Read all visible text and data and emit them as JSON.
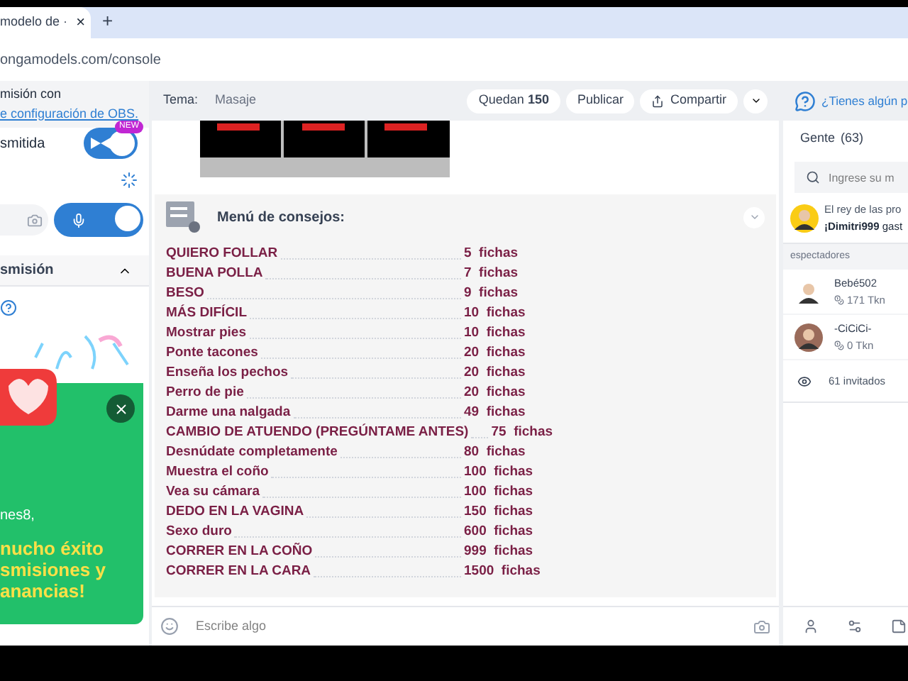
{
  "browser": {
    "tab_title": "modelo de ·",
    "close": "×",
    "new_tab": "+",
    "url": "ongamodels.com/console"
  },
  "left_panel": {
    "obs_line": "misión con",
    "obs_link": "e configuración de OBS.",
    "broadcast_label": "smitida",
    "broadcast_toggle": {
      "on": true,
      "badge": "NEW"
    },
    "mic_toggle": {
      "on": true
    },
    "section_title": "smisión",
    "section_expanded": true,
    "promo": {
      "greeting": "nes8,",
      "message": "nucho éxito smisiones y anancias!"
    }
  },
  "topic_bar": {
    "label": "Tema:",
    "value": "Masaje",
    "remaining_prefix": "Quedan",
    "remaining": "150",
    "publish": "Publicar",
    "share": "Compartir"
  },
  "tip_menu": {
    "title": "Menú de consejos:",
    "items": [
      {
        "name": "QUIERO FOLLAR",
        "price": "5  fichas"
      },
      {
        "name": "BUENA POLLA",
        "price": "7  fichas"
      },
      {
        "name": "BESO",
        "price": "9  fichas"
      },
      {
        "name": "MÁS DIFÍCIL",
        "price": "10  fichas"
      },
      {
        "name": "Mostrar pies",
        "price": "10  fichas"
      },
      {
        "name": "Ponte tacones",
        "price": "20  fichas"
      },
      {
        "name": "Enseña los pechos",
        "price": "20  fichas"
      },
      {
        "name": "Perro de pie",
        "price": "20  fichas"
      },
      {
        "name": "Darme una nalgada",
        "price": "49  fichas"
      },
      {
        "name": "CAMBIO DE ATUENDO (PREGÚNTAME ANTES)",
        "price": "75  fichas"
      },
      {
        "name": "Desnúdate completamente",
        "price": "80  fichas"
      },
      {
        "name": "Muestra el coño",
        "price": "100  fichas"
      },
      {
        "name": "Vea su cámara",
        "price": "100  fichas"
      },
      {
        "name": "DEDO EN LA VAGINA",
        "price": "150  fichas"
      },
      {
        "name": "Sexo duro",
        "price": "600  fichas"
      },
      {
        "name": "CORRER EN LA COÑO",
        "price": "999  fichas"
      },
      {
        "name": "CORRER EN LA CARA",
        "price": "1500  fichas"
      }
    ]
  },
  "chat_input": {
    "placeholder": "Escribe algo"
  },
  "right_panel": {
    "help": "¿Tienes algún p",
    "people_tab": "Gente",
    "people_count": "(63)",
    "search_placeholder": "Ingrese su m",
    "notice": {
      "line1": "El rey de las pro",
      "user": "¡Dimitri999",
      "rest": " gast"
    },
    "viewers_label": "espectadores",
    "viewers": [
      {
        "name": "Bebé502",
        "tokens": "171 Tkn"
      },
      {
        "name": "-CiCiCi-",
        "tokens": "0 Tkn"
      }
    ],
    "guests": "61 invitados"
  }
}
